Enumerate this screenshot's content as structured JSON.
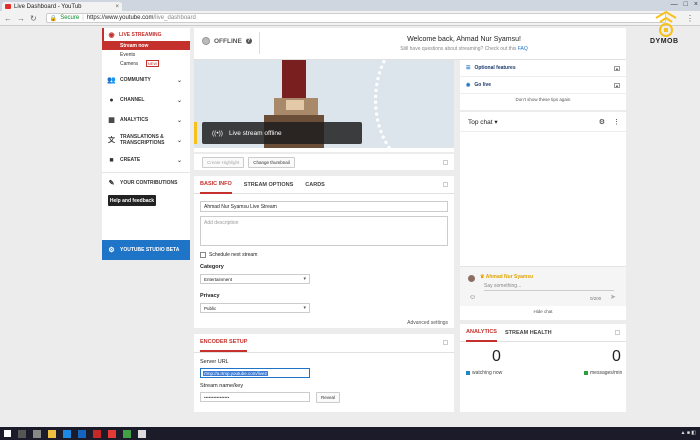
{
  "browser": {
    "tab_title": "Live Dashboard - YouTub",
    "tab_close": "×",
    "window_controls": [
      "—",
      "□",
      "×"
    ],
    "secure_label": "Secure",
    "url_host": "https://www.youtube.com",
    "url_path": "/live_dashboard"
  },
  "sidebar": {
    "live_streaming": "LIVE STREAMING",
    "sub_items": [
      {
        "label": "Stream now",
        "active": true
      },
      {
        "label": "Events",
        "active": false
      },
      {
        "label": "Camera",
        "active": false,
        "badge": "NEW"
      }
    ],
    "items": [
      {
        "label": "COMMUNITY",
        "icon": "people-icon"
      },
      {
        "label": "CHANNEL",
        "icon": "user-icon"
      },
      {
        "label": "ANALYTICS",
        "icon": "bar-chart-icon"
      },
      {
        "label": "TRANSLATIONS & TRANSCRIPTIONS",
        "icon": "translate-icon"
      },
      {
        "label": "CREATE",
        "icon": "video-icon"
      }
    ],
    "contributions": "YOUR CONTRIBUTIONS",
    "help_button": "Help and feedback",
    "studio_beta": "YOUTUBE STUDIO BETA"
  },
  "header": {
    "status": "OFFLINE",
    "welcome": "Welcome back, Ahmad Nur Syamsu!",
    "question": "Still have questions about streaming? Check out this ",
    "faq": "FAQ"
  },
  "preview": {
    "overlay_text": "Live stream offline",
    "create_highlight": "Create Highlight",
    "change_thumbnail": "Change thumbnail"
  },
  "info": {
    "tabs": [
      "BASIC INFO",
      "STREAM OPTIONS",
      "CARDS"
    ],
    "title_value": "Ahmad Nur Syamsu Live Stream",
    "description_placeholder": "Add description",
    "schedule_label": "Schedule next stream",
    "category_label": "Category",
    "category_value": "Entertainment",
    "privacy_label": "Privacy",
    "privacy_value": "Public",
    "advanced": "Advanced settings"
  },
  "encoder": {
    "tab": "ENCODER SETUP",
    "server_label": "Server URL",
    "server_value": "rtmp://a.rtmp.youtube.com/live2",
    "key_label": "Stream name/key",
    "key_value": "••••••••••••••••",
    "reveal": "Reveal"
  },
  "right": {
    "optional_features": "Optional features",
    "go_live": "Go live",
    "tips": "Don't show these tips again",
    "chat_title": "Top chat",
    "chat_user": "Ahmad Nur Syamsu",
    "chat_placeholder": "Say something...",
    "chat_count": "0/200",
    "hide_chat": "Hide chat",
    "stats_tabs": [
      "ANALYTICS",
      "STREAM HEALTH"
    ],
    "watching_value": "0",
    "watching_label": "watching now",
    "messages_value": "0",
    "messages_label": "messages/min"
  },
  "logo_text": "DYMOB",
  "colors": {
    "accent": "#c4302b",
    "studio": "#1e74c6",
    "watching": "#1e88c7",
    "messages": "#2e9e3e"
  }
}
